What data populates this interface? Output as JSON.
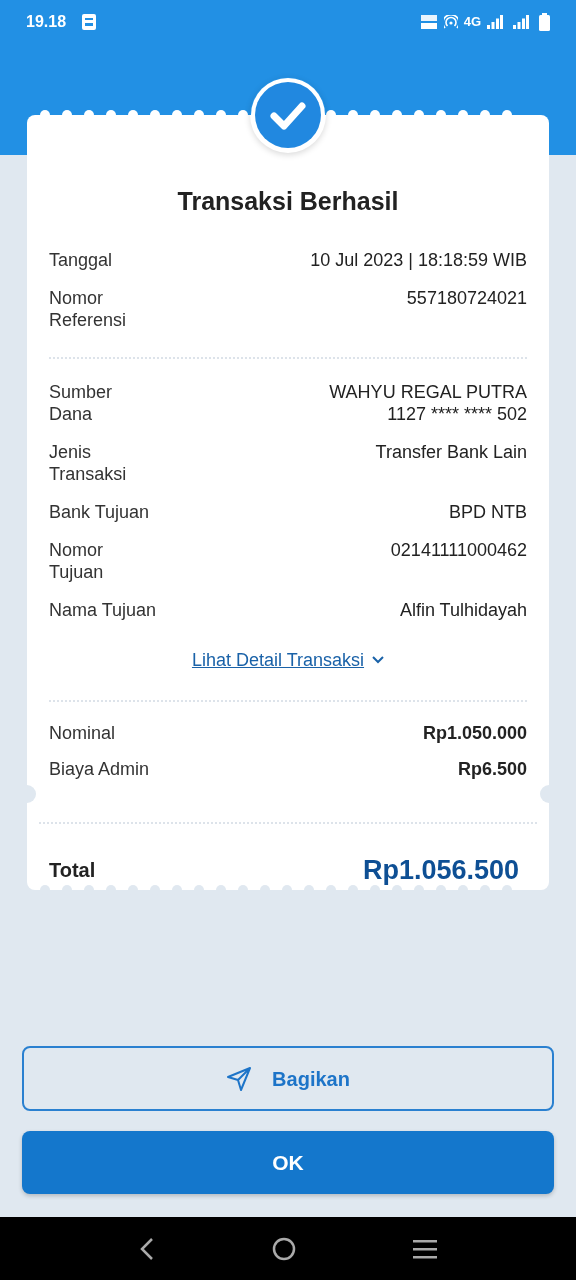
{
  "status_bar": {
    "time": "19.18",
    "network": "4G"
  },
  "receipt": {
    "title": "Transaksi Berhasil",
    "sections": [
      {
        "kind": "detail",
        "rows": [
          {
            "label": "Tanggal",
            "values": [
              "10 Jul 2023 | 18:18:59 WIB"
            ]
          },
          {
            "label": "Nomor Referensi",
            "values": [
              "557180724021"
            ]
          }
        ]
      },
      {
        "kind": "detail",
        "rows": [
          {
            "label": "Sumber Dana",
            "values": [
              "WAHYU REGAL PUTRA",
              "1127 **** **** 502"
            ]
          },
          {
            "label": "Jenis Transaksi",
            "values": [
              "Transfer Bank Lain"
            ]
          },
          {
            "label": "Bank Tujuan",
            "values": [
              "BPD NTB"
            ]
          },
          {
            "label": "Nomor Tujuan",
            "values": [
              "02141111000462"
            ]
          },
          {
            "label": "Nama Tujuan",
            "values": [
              "Alfin Tulhidayah"
            ]
          }
        ],
        "link": "Lihat Detail Transaksi"
      },
      {
        "kind": "amount",
        "rows": [
          {
            "label": "Nominal",
            "values": [
              "Rp1.050.000"
            ]
          },
          {
            "label": "Biaya Admin",
            "values": [
              "Rp6.500"
            ]
          }
        ]
      }
    ],
    "total": {
      "label": "Total",
      "value": "Rp1.056.500"
    }
  },
  "buttons": [
    {
      "kind": "outline",
      "label": "Bagikan"
    },
    {
      "kind": "primary",
      "label": "OK"
    }
  ]
}
